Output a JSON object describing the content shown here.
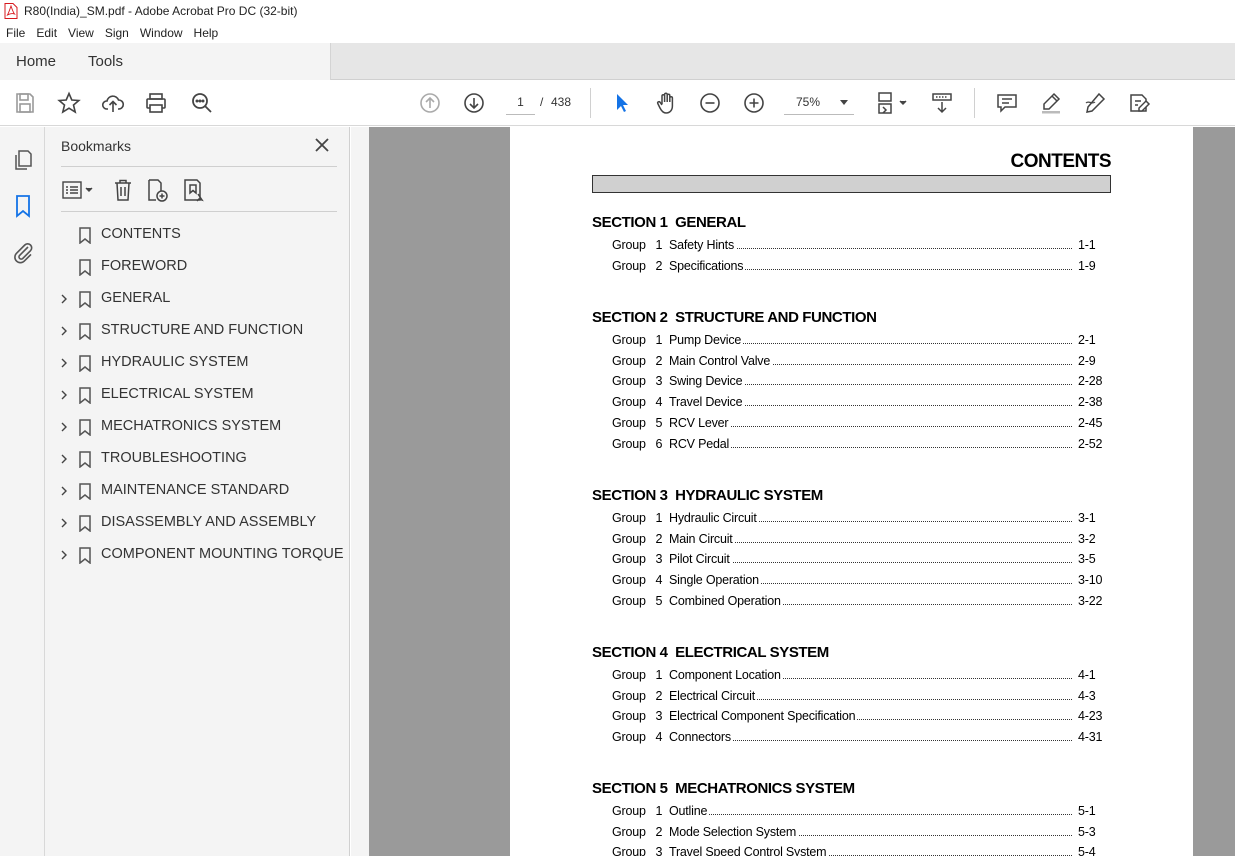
{
  "window": {
    "title": "R80(India)_SM.pdf - Adobe Acrobat Pro DC (32-bit)"
  },
  "menu": [
    "File",
    "Edit",
    "View",
    "Sign",
    "Window",
    "Help"
  ],
  "tabs": {
    "home": "Home",
    "tools": "Tools"
  },
  "toolbar": {
    "current_page": "1",
    "page_separator": "/",
    "total_pages": "438",
    "zoom": "75%"
  },
  "panel": {
    "title": "Bookmarks",
    "items": [
      {
        "label": "CONTENTS",
        "expandable": false
      },
      {
        "label": "FOREWORD",
        "expandable": false
      },
      {
        "label": "GENERAL",
        "expandable": true
      },
      {
        "label": "STRUCTURE AND FUNCTION",
        "expandable": true
      },
      {
        "label": "HYDRAULIC SYSTEM",
        "expandable": true
      },
      {
        "label": "ELECTRICAL SYSTEM",
        "expandable": true
      },
      {
        "label": "MECHATRONICS SYSTEM",
        "expandable": true
      },
      {
        "label": "TROUBLESHOOTING",
        "expandable": true
      },
      {
        "label": "MAINTENANCE STANDARD",
        "expandable": true
      },
      {
        "label": "DISASSEMBLY AND ASSEMBLY",
        "expandable": true
      },
      {
        "label": "COMPONENT MOUNTING TORQUE",
        "expandable": true
      }
    ]
  },
  "document": {
    "title": "CONTENTS",
    "sections": [
      {
        "heading": "SECTION 1  GENERAL",
        "groups": [
          {
            "group": "Group   1",
            "name": "Safety Hints",
            "page": "1-1"
          },
          {
            "group": "Group   2",
            "name": "Specifications",
            "page": "1-9"
          }
        ]
      },
      {
        "heading": "SECTION 2  STRUCTURE AND FUNCTION",
        "groups": [
          {
            "group": "Group   1",
            "name": "Pump Device",
            "page": "2-1"
          },
          {
            "group": "Group   2",
            "name": "Main Control Valve",
            "page": "2-9"
          },
          {
            "group": "Group   3",
            "name": "Swing Device",
            "page": "2-28"
          },
          {
            "group": "Group   4",
            "name": "Travel Device",
            "page": "2-38"
          },
          {
            "group": "Group   5",
            "name": "RCV Lever",
            "page": "2-45"
          },
          {
            "group": "Group   6",
            "name": "RCV Pedal",
            "page": "2-52"
          }
        ]
      },
      {
        "heading": "SECTION 3  HYDRAULIC SYSTEM",
        "groups": [
          {
            "group": "Group   1",
            "name": "Hydraulic Circuit",
            "page": "3-1"
          },
          {
            "group": "Group   2",
            "name": "Main Circuit",
            "page": "3-2"
          },
          {
            "group": "Group   3",
            "name": "Pilot Circuit",
            "page": "3-5"
          },
          {
            "group": "Group   4",
            "name": "Single Operation",
            "page": "3-10"
          },
          {
            "group": "Group   5",
            "name": "Combined Operation",
            "page": "3-22"
          }
        ]
      },
      {
        "heading": "SECTION 4  ELECTRICAL SYSTEM",
        "groups": [
          {
            "group": "Group   1",
            "name": "Component Location",
            "page": "4-1"
          },
          {
            "group": "Group   2",
            "name": "Electrical Circuit",
            "page": "4-3"
          },
          {
            "group": "Group   3",
            "name": "Electrical Component Specification",
            "page": "4-23"
          },
          {
            "group": "Group   4",
            "name": "Connectors",
            "page": "4-31"
          }
        ]
      },
      {
        "heading": "SECTION 5  MECHATRONICS SYSTEM",
        "groups": [
          {
            "group": "Group   1",
            "name": "Outline",
            "page": "5-1"
          },
          {
            "group": "Group   2",
            "name": "Mode Selection System",
            "page": "5-3"
          },
          {
            "group": "Group   3",
            "name": "Travel Speed Control System",
            "page": "5-4"
          }
        ]
      }
    ]
  },
  "colors": {
    "accent": "#1473e6",
    "pdf_red": "#d7181e",
    "canvas_gray": "#9a9a9a"
  }
}
